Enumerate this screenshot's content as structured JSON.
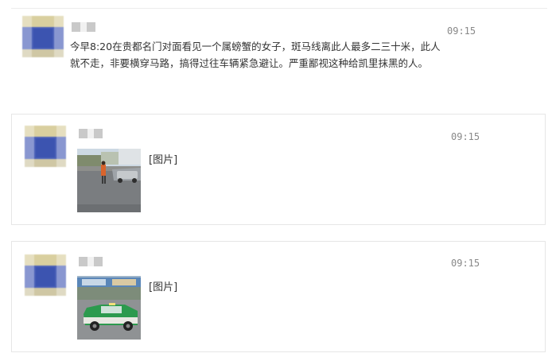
{
  "messages": [
    {
      "time": "09:15",
      "text": "今早8:20在贵都名门对面看见一个属螃蟹的女子，斑马线离此人最多二三十米，此人就不走，非要横穿马路，搞得过往车辆紧急避让。严重鄙视这种给凯里抹黑的人。"
    },
    {
      "time": "09:15",
      "label": "[图片]",
      "image_desc": "street-photo-pedestrian"
    },
    {
      "time": "09:15",
      "label": "[图片]",
      "image_desc": "street-photo-green-taxi"
    }
  ]
}
